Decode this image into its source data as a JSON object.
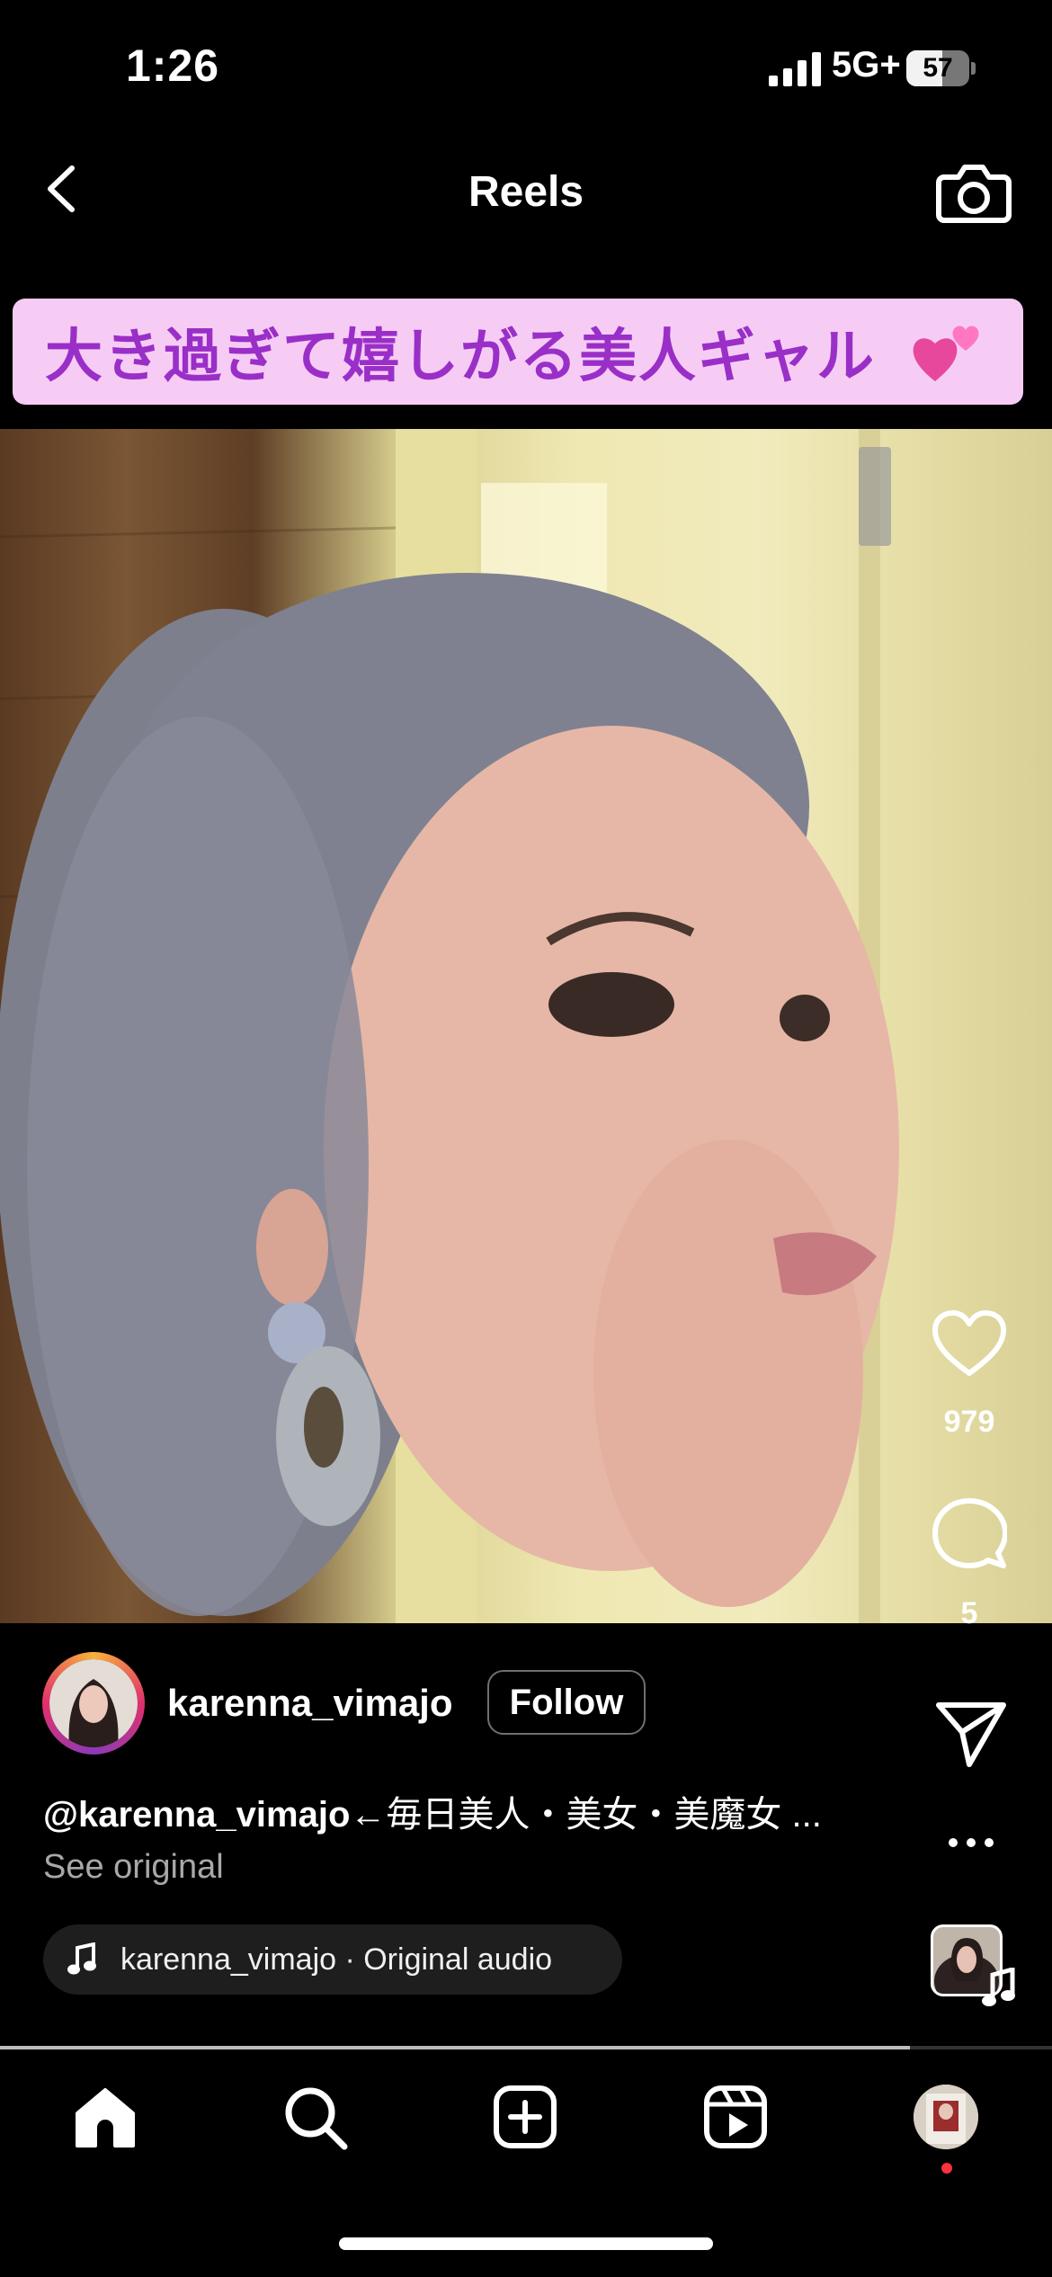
{
  "status_bar": {
    "time": "1:26",
    "network": "5G+",
    "battery": "57",
    "battery_level": 0.57
  },
  "header": {
    "title": "Reels"
  },
  "banner": {
    "text": "大き過ぎて嬉しがる美人ギャル"
  },
  "actions": {
    "like_count": "979",
    "comment_count": "5"
  },
  "author": {
    "username": "karenna_vimajo",
    "follow_label": "Follow"
  },
  "caption": {
    "mention": "@karenna_vimajo",
    "text": "←毎日美人・美女・美魔女 ...",
    "see_original": "See original"
  },
  "audio": {
    "label": "karenna_vimajo · Original audio"
  },
  "progress": {
    "fraction": 0.865
  },
  "nav": {
    "active": "home",
    "items": [
      "home",
      "search",
      "create",
      "reels",
      "profile"
    ]
  },
  "colors": {
    "banner_bg": "#f6ccf5",
    "banner_text": "#9a2fc8",
    "notification": "#ff3040"
  }
}
